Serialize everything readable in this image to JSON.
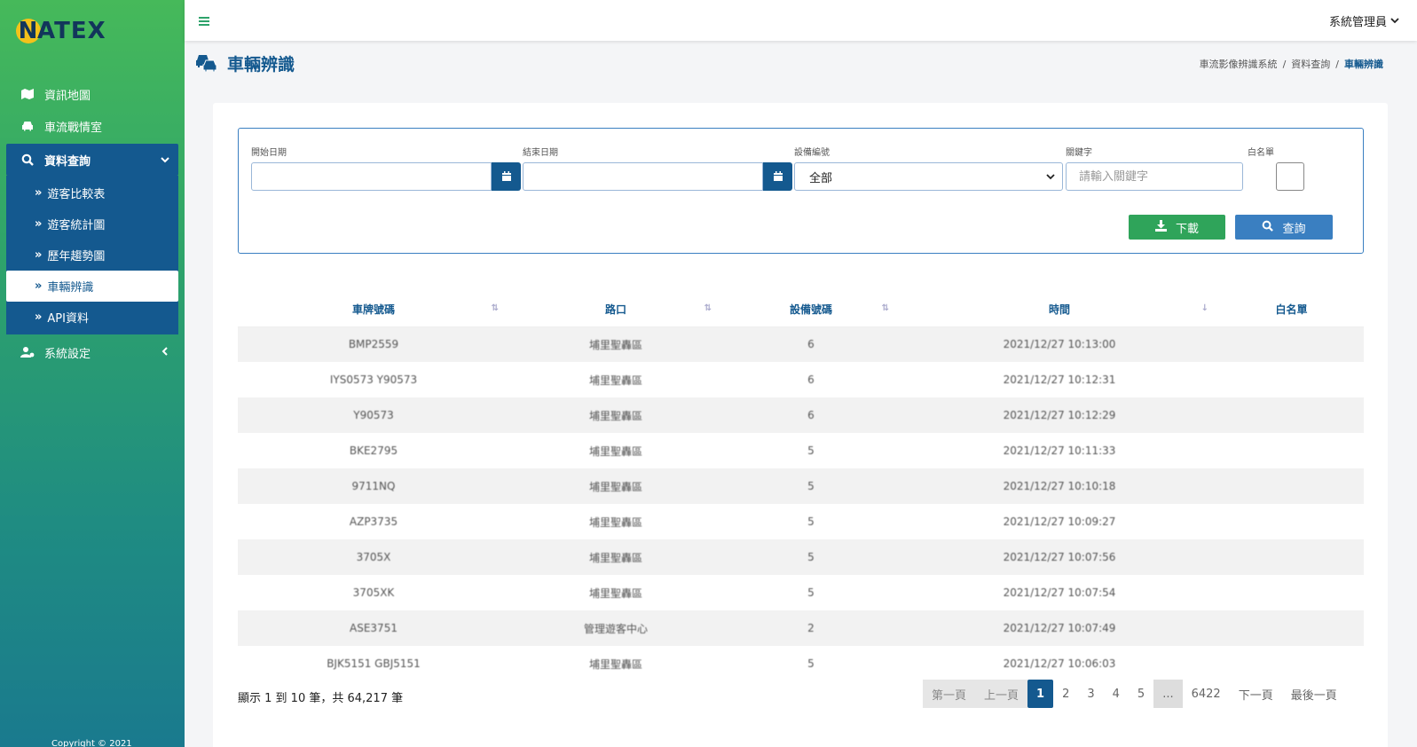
{
  "brand": "NATEX",
  "sidebar": {
    "items": [
      {
        "label": "資訊地圖"
      },
      {
        "label": "車流戰情室"
      },
      {
        "label": "資料查詢"
      },
      {
        "label": "系統設定"
      }
    ],
    "submenu": [
      {
        "label": "遊客比較表"
      },
      {
        "label": "遊客統計圖"
      },
      {
        "label": "歷年趨勢圖"
      },
      {
        "label": "車輛辨識"
      },
      {
        "label": "API資料"
      }
    ],
    "copyright": "Copyright © 2021"
  },
  "topbar": {
    "user": "系統管理員"
  },
  "page": {
    "title": "車輛辨識"
  },
  "breadcrumb": {
    "items": [
      "車流影像辨識系統",
      "資料查詢",
      "車輛辨識"
    ]
  },
  "filters": {
    "start_date_label": "開始日期",
    "end_date_label": "結束日期",
    "device_label": "設備編號",
    "device_value": "全部",
    "keyword_label": "關鍵字",
    "keyword_placeholder": "請輸入關鍵字",
    "whitelist_label": "白名單",
    "download_label": "下載",
    "query_label": "查詢"
  },
  "table": {
    "columns": [
      "車牌號碼",
      "路口",
      "設備號碼",
      "時間",
      "白名單"
    ],
    "rows": [
      [
        "BMP2559",
        "埔里聖轟區",
        "6",
        "2021/12/27 10:13:00",
        ""
      ],
      [
        "IYS0573 Y90573",
        "埔里聖轟區",
        "6",
        "2021/12/27 10:12:31",
        ""
      ],
      [
        "Y90573",
        "埔里聖轟區",
        "6",
        "2021/12/27 10:12:29",
        ""
      ],
      [
        "BKE2795",
        "埔里聖轟區",
        "5",
        "2021/12/27 10:11:33",
        ""
      ],
      [
        "9711NQ",
        "埔里聖轟區",
        "5",
        "2021/12/27 10:10:18",
        ""
      ],
      [
        "AZP3735",
        "埔里聖轟區",
        "5",
        "2021/12/27 10:09:27",
        ""
      ],
      [
        "3705X",
        "埔里聖轟區",
        "5",
        "2021/12/27 10:07:56",
        ""
      ],
      [
        "3705XK",
        "埔里聖轟區",
        "5",
        "2021/12/27 10:07:54",
        ""
      ],
      [
        "ASE3751",
        "管理遊客中心",
        "2",
        "2021/12/27 10:07:49",
        ""
      ],
      [
        "BJK5151 GBJ5151",
        "埔里聖轟區",
        "5",
        "2021/12/27 10:06:03",
        ""
      ]
    ]
  },
  "summary": "顯示 1 到 10 筆，共 64,217 筆",
  "pagination": {
    "first": "第一頁",
    "prev": "上一頁",
    "pages": [
      "1",
      "2",
      "3",
      "4",
      "5"
    ],
    "ellipsis": "...",
    "last_page": "6422",
    "next": "下一頁",
    "last": "最後一頁"
  },
  "colors": {
    "primary": "#14598f",
    "green": "#2fa45a",
    "blue": "#3a7fc1"
  }
}
